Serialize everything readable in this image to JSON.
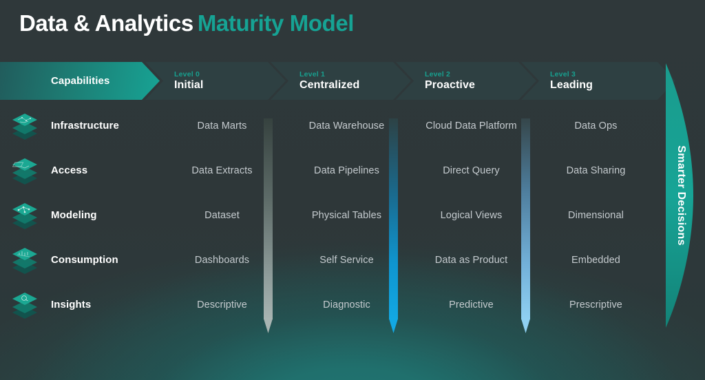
{
  "title": {
    "primary": "Data & Analytics",
    "accent": "Maturity Model"
  },
  "header": {
    "capabilities_label": "Capabilities",
    "levels": [
      {
        "level": "Level 0",
        "name": "Initial"
      },
      {
        "level": "Level 1",
        "name": "Centralized"
      },
      {
        "level": "Level 2",
        "name": "Proactive"
      },
      {
        "level": "Level 3",
        "name": "Leading"
      }
    ]
  },
  "side_banner": {
    "label": "Smarter Decisions"
  },
  "arrows": [
    {
      "name": "progression-arrow-1",
      "color": "#a8b4b2"
    },
    {
      "name": "progression-arrow-2",
      "color": "#12a8e4"
    },
    {
      "name": "progression-arrow-3",
      "color": "#8fd0f2"
    }
  ],
  "colors": {
    "background": "#2e3739",
    "accent_teal": "#16a394",
    "level_label_teal": "#18a08f",
    "cell_text": "#c5cbcf",
    "chevron_dark": "#2e4042",
    "glow_teal": "#1f7572"
  },
  "matrix": {
    "rows": [
      {
        "capability": "Infrastructure",
        "icon": "layered-data-diamond-icon",
        "cells": [
          "Data Marts",
          "Data Warehouse",
          "Cloud Data Platform",
          "Data Ops"
        ]
      },
      {
        "capability": "Access",
        "icon": "layered-data-diamond-icon",
        "cells": [
          "Data Extracts",
          "Data Pipelines",
          "Direct Query",
          "Data Sharing"
        ]
      },
      {
        "capability": "Modeling",
        "icon": "layered-data-diamond-icon",
        "cells": [
          "Dataset",
          "Physical Tables",
          "Logical Views",
          "Dimensional"
        ]
      },
      {
        "capability": "Consumption",
        "icon": "layered-data-diamond-icon",
        "cells": [
          "Dashboards",
          "Self Service",
          "Data as Product",
          "Embedded"
        ]
      },
      {
        "capability": "Insights",
        "icon": "layered-data-diamond-icon",
        "cells": [
          "Descriptive",
          "Diagnostic",
          "Predictive",
          "Prescriptive"
        ]
      }
    ]
  }
}
